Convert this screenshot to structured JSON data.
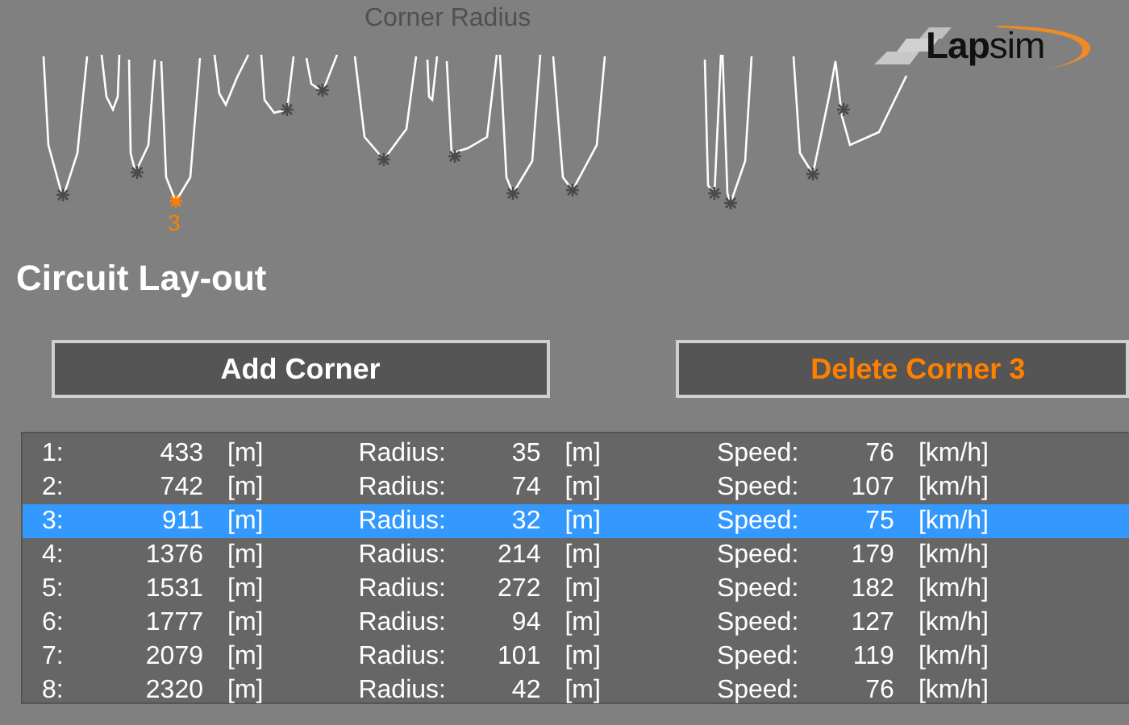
{
  "chart": {
    "title": "Corner Radius",
    "marker_label": "3"
  },
  "logo": {
    "text": "**Lap**sim"
  },
  "heading": "Circuit Lay-out",
  "buttons": [
    {
      "label": "Add Corner",
      "kind": "add"
    },
    {
      "label": "Delete Corner 3",
      "kind": "delete"
    }
  ],
  "corners": [
    {
      "index": "1:",
      "distance": "433",
      "distance_unit": "[m]",
      "radius_label": "Radius:",
      "radius": "35",
      "radius_unit": "[m]",
      "speed_label": "Speed:",
      "speed": "76",
      "speed_unit": "[km/h]",
      "selected": false
    },
    {
      "index": "2:",
      "distance": "742",
      "distance_unit": "[m]",
      "radius_label": "Radius:",
      "radius": "74",
      "radius_unit": "[m]",
      "speed_label": "Speed:",
      "speed": "107",
      "speed_unit": "[km/h]",
      "selected": false
    },
    {
      "index": "3:",
      "distance": "911",
      "distance_unit": "[m]",
      "radius_label": "Radius:",
      "radius": "32",
      "radius_unit": "[m]",
      "speed_label": "Speed:",
      "speed": "75",
      "speed_unit": "[km/h]",
      "selected": true
    },
    {
      "index": "4:",
      "distance": "1376",
      "distance_unit": "[m]",
      "radius_label": "Radius:",
      "radius": "214",
      "radius_unit": "[m]",
      "speed_label": "Speed:",
      "speed": "179",
      "speed_unit": "[km/h]",
      "selected": false
    },
    {
      "index": "5:",
      "distance": "1531",
      "distance_unit": "[m]",
      "radius_label": "Radius:",
      "radius": "272",
      "radius_unit": "[m]",
      "speed_label": "Speed:",
      "speed": "182",
      "speed_unit": "[km/h]",
      "selected": false
    },
    {
      "index": "6:",
      "distance": "1777",
      "distance_unit": "[m]",
      "radius_label": "Radius:",
      "radius": "94",
      "radius_unit": "[m]",
      "speed_label": "Speed:",
      "speed": "127",
      "speed_unit": "[km/h]",
      "selected": false
    },
    {
      "index": "7:",
      "distance": "2079",
      "distance_unit": "[m]",
      "radius_label": "Radius:",
      "radius": "101",
      "radius_unit": "[m]",
      "speed_label": "Speed:",
      "speed": "119",
      "speed_unit": "[km/h]",
      "selected": false
    },
    {
      "index": "8:",
      "distance": "2320",
      "distance_unit": "[m]",
      "radius_label": "Radius:",
      "radius": "42",
      "radius_unit": "[m]",
      "speed_label": "Speed:",
      "speed": "76",
      "speed_unit": "[km/h]",
      "selected": false
    }
  ]
}
